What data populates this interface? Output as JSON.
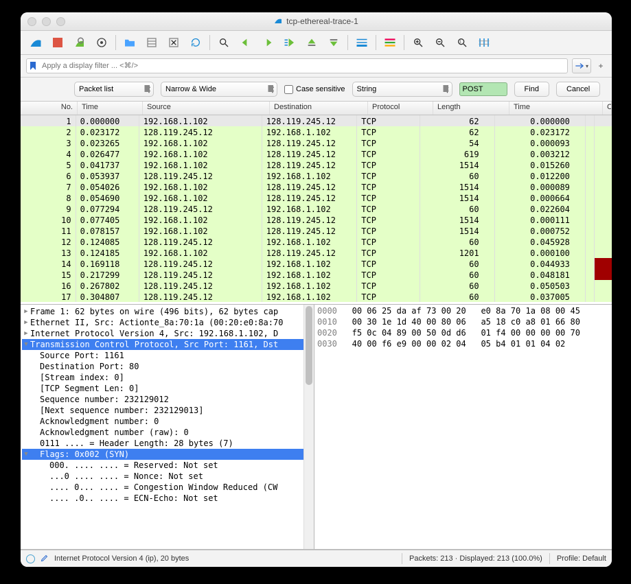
{
  "window": {
    "title": "tcp-ethereal-trace-1"
  },
  "filterbar": {
    "placeholder": "Apply a display filter ... <⌘/>"
  },
  "findbar": {
    "scope_label": "Packet list",
    "charwidth_label": "Narrow & Wide",
    "case_label": "Case sensitive",
    "type_label": "String",
    "term": "POST",
    "find_label": "Find",
    "cancel_label": "Cancel"
  },
  "headers": {
    "no": "No.",
    "time": "Time",
    "src": "Source",
    "dst": "Destination",
    "proto": "Protocol",
    "len": "Length",
    "time2": "Time",
    "calc": "Calculated wi"
  },
  "packets": [
    {
      "no": "1",
      "t": "0.000000",
      "s": "192.168.1.102",
      "d": "128.119.245.12",
      "p": "TCP",
      "l": "62",
      "t2": "0.000000",
      "sel": true
    },
    {
      "no": "2",
      "t": "0.023172",
      "s": "128.119.245.12",
      "d": "192.168.1.102",
      "p": "TCP",
      "l": "62",
      "t2": "0.023172"
    },
    {
      "no": "3",
      "t": "0.023265",
      "s": "192.168.1.102",
      "d": "128.119.245.12",
      "p": "TCP",
      "l": "54",
      "t2": "0.000093"
    },
    {
      "no": "4",
      "t": "0.026477",
      "s": "192.168.1.102",
      "d": "128.119.245.12",
      "p": "TCP",
      "l": "619",
      "t2": "0.003212"
    },
    {
      "no": "5",
      "t": "0.041737",
      "s": "192.168.1.102",
      "d": "128.119.245.12",
      "p": "TCP",
      "l": "1514",
      "t2": "0.015260"
    },
    {
      "no": "6",
      "t": "0.053937",
      "s": "128.119.245.12",
      "d": "192.168.1.102",
      "p": "TCP",
      "l": "60",
      "t2": "0.012200"
    },
    {
      "no": "7",
      "t": "0.054026",
      "s": "192.168.1.102",
      "d": "128.119.245.12",
      "p": "TCP",
      "l": "1514",
      "t2": "0.000089"
    },
    {
      "no": "8",
      "t": "0.054690",
      "s": "192.168.1.102",
      "d": "128.119.245.12",
      "p": "TCP",
      "l": "1514",
      "t2": "0.000664"
    },
    {
      "no": "9",
      "t": "0.077294",
      "s": "128.119.245.12",
      "d": "192.168.1.102",
      "p": "TCP",
      "l": "60",
      "t2": "0.022604"
    },
    {
      "no": "10",
      "t": "0.077405",
      "s": "192.168.1.102",
      "d": "128.119.245.12",
      "p": "TCP",
      "l": "1514",
      "t2": "0.000111"
    },
    {
      "no": "11",
      "t": "0.078157",
      "s": "192.168.1.102",
      "d": "128.119.245.12",
      "p": "TCP",
      "l": "1514",
      "t2": "0.000752"
    },
    {
      "no": "12",
      "t": "0.124085",
      "s": "128.119.245.12",
      "d": "192.168.1.102",
      "p": "TCP",
      "l": "60",
      "t2": "0.045928"
    },
    {
      "no": "13",
      "t": "0.124185",
      "s": "192.168.1.102",
      "d": "128.119.245.12",
      "p": "TCP",
      "l": "1201",
      "t2": "0.000100"
    },
    {
      "no": "14",
      "t": "0.169118",
      "s": "128.119.245.12",
      "d": "192.168.1.102",
      "p": "TCP",
      "l": "60",
      "t2": "0.044933",
      "rtt": "red"
    },
    {
      "no": "15",
      "t": "0.217299",
      "s": "128.119.245.12",
      "d": "192.168.1.102",
      "p": "TCP",
      "l": "60",
      "t2": "0.048181",
      "rtt": "red"
    },
    {
      "no": "16",
      "t": "0.267802",
      "s": "128.119.245.12",
      "d": "192.168.1.102",
      "p": "TCP",
      "l": "60",
      "t2": "0.050503"
    },
    {
      "no": "17",
      "t": "0.304807",
      "s": "128.119.245.12",
      "d": "192.168.1.102",
      "p": "TCP",
      "l": "60",
      "t2": "0.037005"
    }
  ],
  "details": [
    {
      "tri": "▶",
      "indent": 0,
      "text": "Frame 1: 62 bytes on wire (496 bits), 62 bytes cap"
    },
    {
      "tri": "▶",
      "indent": 0,
      "text": "Ethernet II, Src: Actionte_8a:70:1a (00:20:e0:8a:70"
    },
    {
      "tri": "▶",
      "indent": 0,
      "text": "Internet Protocol Version 4, Src: 192.168.1.102, D"
    },
    {
      "tri": "▼",
      "indent": 0,
      "text": "Transmission Control Protocol, Src Port: 1161, Dst",
      "sel": true
    },
    {
      "tri": "",
      "indent": 1,
      "text": "Source Port: 1161"
    },
    {
      "tri": "",
      "indent": 1,
      "text": "Destination Port: 80"
    },
    {
      "tri": "",
      "indent": 1,
      "text": "[Stream index: 0]"
    },
    {
      "tri": "",
      "indent": 1,
      "text": "[TCP Segment Len: 0]"
    },
    {
      "tri": "",
      "indent": 1,
      "text": "Sequence number: 232129012"
    },
    {
      "tri": "",
      "indent": 1,
      "text": "[Next sequence number: 232129013]"
    },
    {
      "tri": "",
      "indent": 1,
      "text": "Acknowledgment number: 0"
    },
    {
      "tri": "",
      "indent": 1,
      "text": "Acknowledgment number (raw): 0"
    },
    {
      "tri": "",
      "indent": 1,
      "text": "0111 .... = Header Length: 28 bytes (7)"
    },
    {
      "tri": "▼",
      "indent": 1,
      "text": "Flags: 0x002 (SYN)",
      "sel": true
    },
    {
      "tri": "",
      "indent": 2,
      "text": "000. .... .... = Reserved: Not set"
    },
    {
      "tri": "",
      "indent": 2,
      "text": "...0 .... .... = Nonce: Not set"
    },
    {
      "tri": "",
      "indent": 2,
      "text": ".... 0... .... = Congestion Window Reduced (CW"
    },
    {
      "tri": "",
      "indent": 2,
      "text": ".... .0.. .... = ECN-Echo: Not set"
    }
  ],
  "hex": [
    {
      "off": "0000",
      "b1": "00 06 25 da af 73 00 20",
      "b2": "e0 8a 70 1a 08 00 45"
    },
    {
      "off": "0010",
      "b1": "00 30 1e 1d 40 00 80 06",
      "b2": "a5 18 c0 a8 01 66 80"
    },
    {
      "off": "0020",
      "b1": "f5 0c 04 89 00 50 0d d6",
      "b2": "01 f4 00 00 00 00 70"
    },
    {
      "off": "0030",
      "b1": "40 00 f6 e9 00 00 02 04",
      "b2": "05 b4 01 01 04 02"
    }
  ],
  "status": {
    "left": "Internet Protocol Version 4 (ip), 20 bytes",
    "center": "Packets: 213 · Displayed: 213 (100.0%)",
    "right": "Profile: Default"
  }
}
